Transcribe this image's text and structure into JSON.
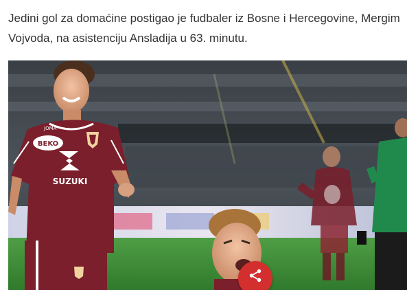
{
  "article": {
    "paragraph": "Jedini gol za domaćine postigao je fudbaler iz Bosne i Hercegovine, Mergim Vojvoda, na asistenciju Ansladija u 63. minutu."
  },
  "photo": {
    "jersey_sponsor": "SUZUKI",
    "jersey_brand": "JOMA",
    "jersey_sleeve": "BEKO",
    "shirt_color": "#7a1f2b",
    "pitch_color": "#3c8f3a",
    "referee_color": "#1f8a4c"
  },
  "share": {
    "icon": "share-icon",
    "color": "#d32f2f"
  }
}
